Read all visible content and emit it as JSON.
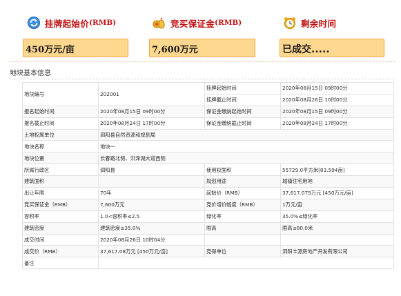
{
  "header": {
    "starting_price": {
      "label": "挂牌起始价",
      "unit": "(RMB)",
      "value": "450万元/亩"
    },
    "deposit": {
      "label": "竞买保证金",
      "unit": "(RMB)",
      "value": "7,600万元"
    },
    "remaining": {
      "label": "剩余时间",
      "value": "已成交....."
    }
  },
  "section_title": "地块基本信息",
  "rows": [
    {
      "c1": "地块编号",
      "c2": "202001",
      "c3": "挂牌起始时间",
      "c4": "2020年08月15日 09时00分"
    },
    {
      "c3": "挂牌截止时间",
      "c4": "2020年08月26日 10时00分"
    },
    {
      "c1": "报名起始时间",
      "c2": "2020年08月15日 09时00分",
      "c3": "保证金缴纳起始时间",
      "c4": "2020年08月15日 09时00分"
    },
    {
      "c1": "报名截止时间",
      "c2": "2020年08月24日 17时00分",
      "c3": "保证金缴纳截止时间",
      "c4": "2020年08月24日 17时00分"
    },
    {
      "c1": "土地权属单位",
      "c2": "泗阳县自然资源和规划局"
    },
    {
      "c1": "地块名称",
      "c2": "地块一"
    },
    {
      "c1": "地块位置",
      "c2": "长春路北侧、洪泽湖大道西侧"
    },
    {
      "c1": "所属行政区",
      "c2": "泗阳县",
      "c3": "使用权面积",
      "c4": "55729.0平方米[83.594亩]"
    },
    {
      "c1": "建筑面积",
      "c2": "",
      "c3": "规划用途",
      "c4": "城镇住宅用地"
    },
    {
      "c1": "出让年限",
      "c2": "70年",
      "c3": "起始价（RMB）",
      "c4": "37,617.075万元 [450万元/亩]"
    },
    {
      "c1": "竞买保证金（RMB）",
      "c2": "7,600万元",
      "c3": "竞价增价幅度（RMB）",
      "c4": "1万元/亩"
    },
    {
      "c1": "容积率",
      "c2": "1.0<容积率≤2.5",
      "c3": "绿化率",
      "c4": "35.0%≤绿化率"
    },
    {
      "c1": "建筑密度",
      "c2": "建筑密度≤35.0%",
      "c3": "限高",
      "c4": "限高≤80.0米"
    },
    {
      "c1": "成交时间",
      "c2": "2020年08月26日 10时04分"
    },
    {
      "c1": "成交价（RMB）",
      "c2": "37,617.08万元 [450万元/亩]",
      "c3": "竞得单位",
      "c4": "泗阳丰源房地产开发有限公司"
    },
    {
      "c1": "备注",
      "c2": ""
    }
  ]
}
